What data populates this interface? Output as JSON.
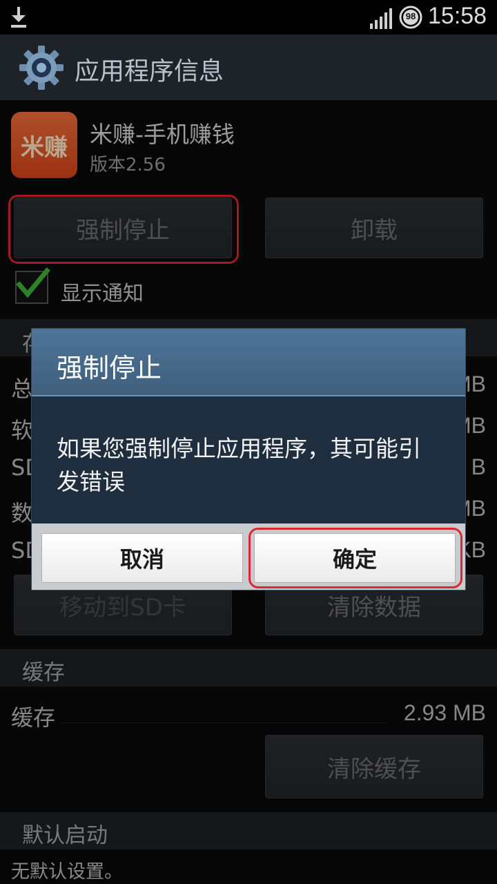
{
  "status_bar": {
    "time": "15:58",
    "battery_level": "98",
    "icons": [
      "download-icon",
      "signal-icon",
      "battery-icon"
    ]
  },
  "header": {
    "title": "应用程序信息",
    "icon": "gear-icon"
  },
  "app": {
    "icon_text": "米赚",
    "name": "米赚-手机赚钱",
    "version": "版本2.56"
  },
  "actions": {
    "force_stop": "强制停止",
    "uninstall": "卸载"
  },
  "notification": {
    "label": "显示通知",
    "checked": true
  },
  "storage": {
    "section_label": "存储",
    "rows": [
      {
        "label": "总",
        "value": "MB"
      },
      {
        "label": "软",
        "value": "MB"
      },
      {
        "label": "SD",
        "value": "B"
      },
      {
        "label": "数",
        "value": "MB"
      },
      {
        "label": "SD",
        "value": "KB"
      }
    ],
    "move_to_sd": "移动到SD卡",
    "clear_data": "清除数据"
  },
  "cache": {
    "section_label": "缓存",
    "label": "缓存",
    "value": "2.93 MB",
    "clear_cache": "清除缓存"
  },
  "default_launch": {
    "section_label": "默认启动",
    "text": "无默认设置。"
  },
  "dialog": {
    "title": "强制停止",
    "message": "如果您强制停止应用程序，其可能引发错误",
    "cancel": "取消",
    "confirm": "确定"
  },
  "colors": {
    "highlight": "#e02531",
    "dialog_title": "#4f7597",
    "check_green": "#3fb53a"
  }
}
